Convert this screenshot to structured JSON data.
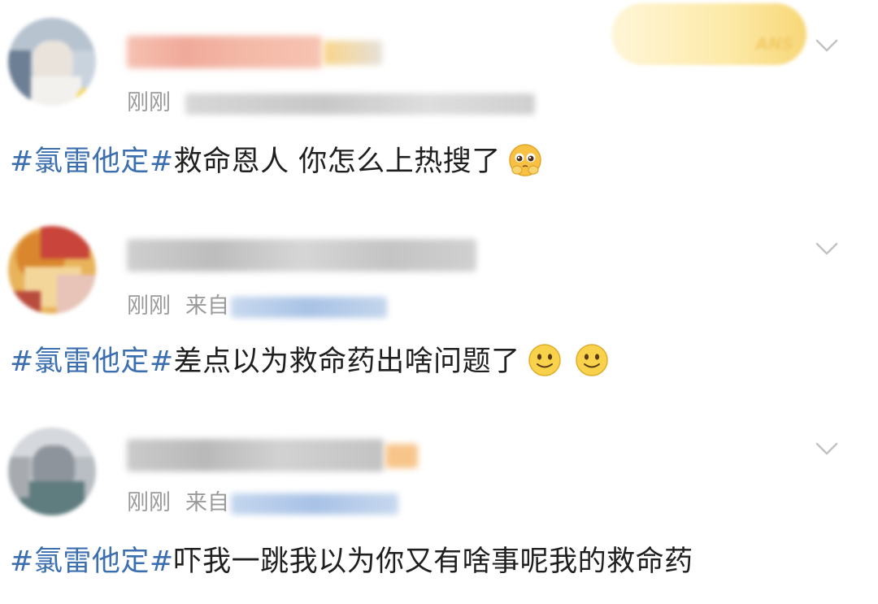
{
  "comments": [
    {
      "time": "刚刚",
      "source_label": "",
      "hashtag": "#氯雷他定#",
      "body": "救命恩人 你怎么上热搜了",
      "emoji_icons": [
        "pleading-face-icon"
      ]
    },
    {
      "time": "刚刚",
      "source_label": "来自",
      "hashtag": "#氯雷他定#",
      "body": "差点以为救命药出啥问题了",
      "emoji_icons": [
        "smiley-face-icon",
        "smiley-face-icon"
      ]
    },
    {
      "time": "刚刚",
      "source_label": "来自",
      "hashtag": "#氯雷他定#",
      "body": "吓我一跳我以为你又有啥事呢我的救命药",
      "emoji_icons": []
    }
  ],
  "fans_badge_text": "ANS",
  "colors": {
    "hashtag": "#3c6fb0",
    "meta_text": "#9a9a9a",
    "body_text": "#1f1f1f",
    "badge_gold": "#f1c761"
  }
}
